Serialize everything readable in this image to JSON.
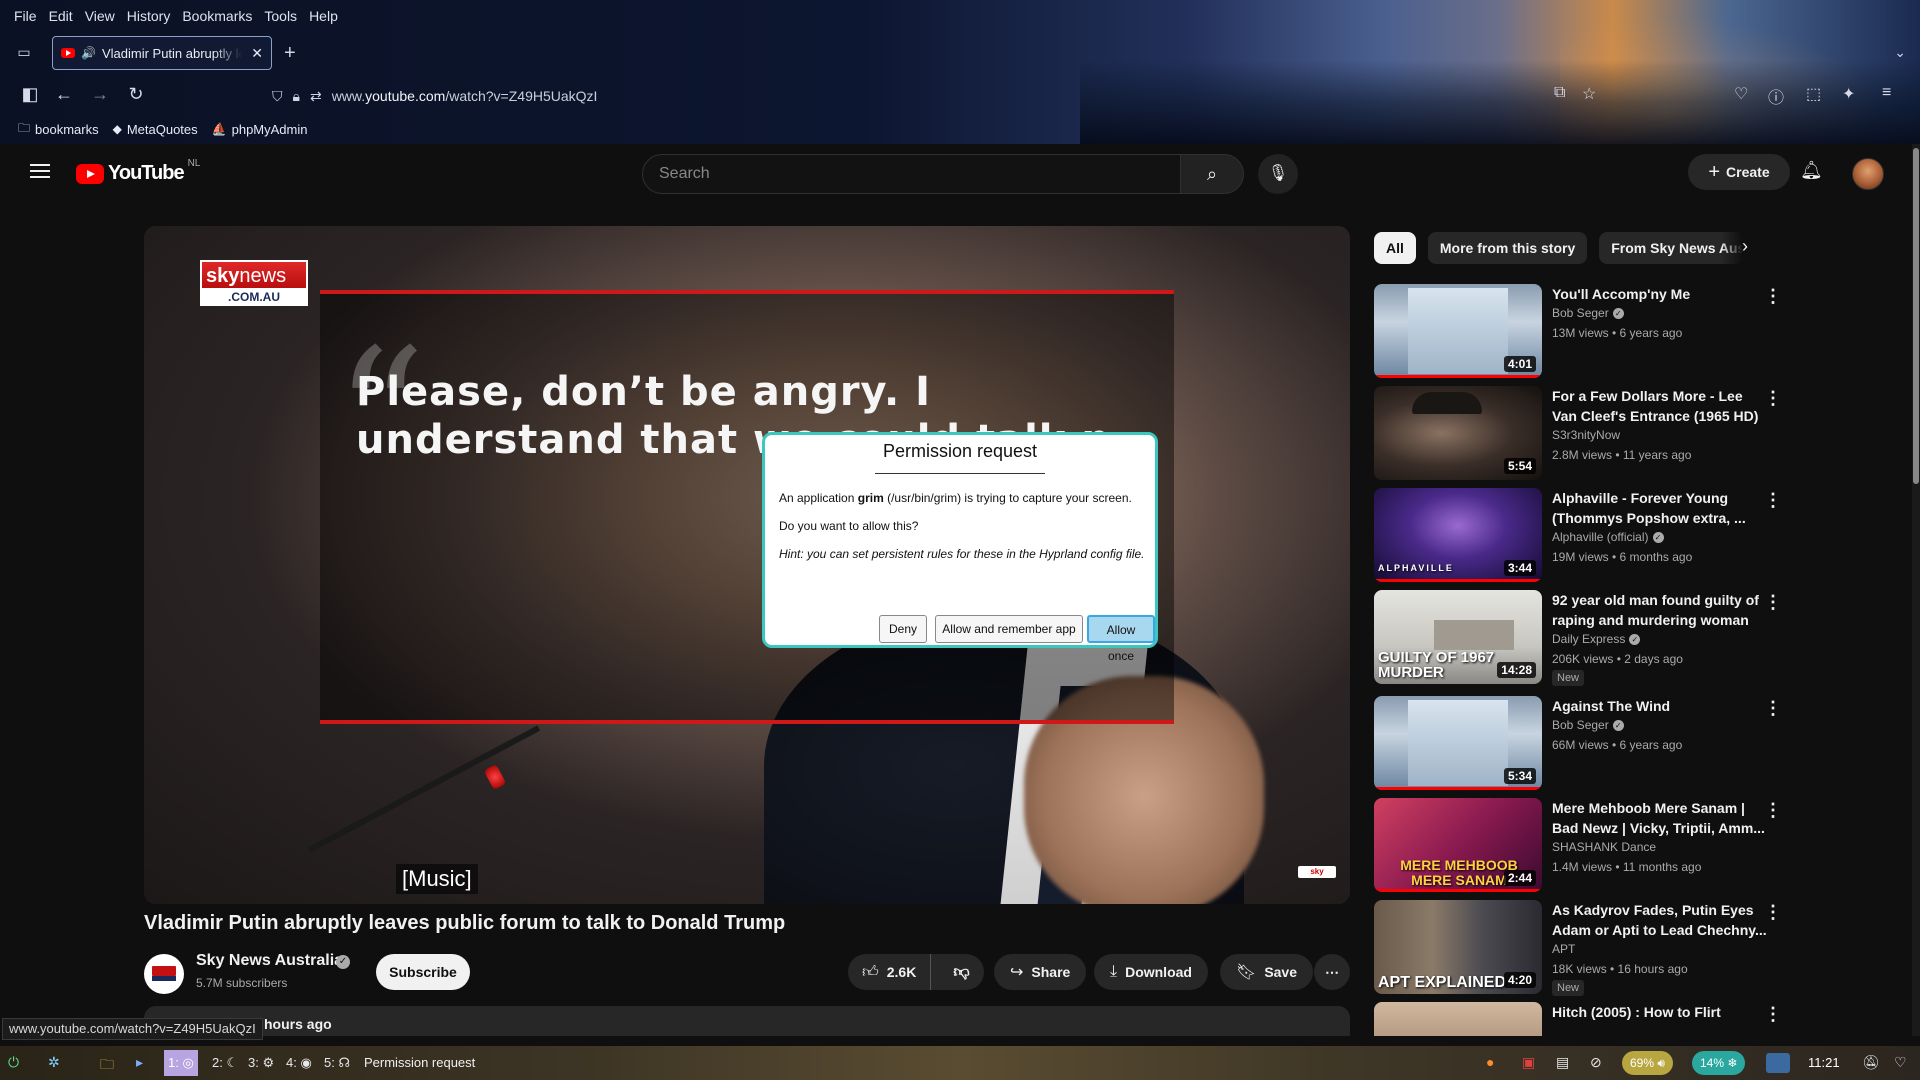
{
  "browser": {
    "menu": [
      "File",
      "Edit",
      "View",
      "History",
      "Bookmarks",
      "Tools",
      "Help"
    ],
    "tab_title": "Vladimir Putin abruptly leaves public forum to talk to Donald Trump",
    "url_prefix": "www.",
    "url_domain": "youtube.com",
    "url_path": "/watch?v=Z49H5UakQzI",
    "bookmarks": [
      "bookmarks",
      "MetaQuotes",
      "phpMyAdmin"
    ],
    "status_url": "www.youtube.com/watch?v=Z49H5UakQzI"
  },
  "youtube": {
    "logo_text": "YouTube",
    "region": "NL",
    "search_placeholder": "Search",
    "create_label": "Create"
  },
  "video": {
    "overlay_logo_top": "sky",
    "overlay_logo_top2": "news",
    "overlay_logo_bottom": ".COM.AU",
    "quote_text": "Please, don’t be angry. I understand that we could talk n",
    "caption": "[Music]",
    "title": "Vladimir Putin abruptly leaves public forum to talk to Donald Trump",
    "channel": "Sky News Australia",
    "subscribers": "5.7M subscribers",
    "subscribe_label": "Subscribe",
    "likes": "2.6K",
    "share_label": "Share",
    "download_label": "Download",
    "save_label": "Save",
    "desc_snippet": "hours ago"
  },
  "chips": [
    "All",
    "More from this story",
    "From Sky News Australia"
  ],
  "recommendations": [
    {
      "title": "You'll Accomp'ny Me",
      "channel": "Bob Seger",
      "verified": true,
      "meta": "13M views • 6 years ago",
      "duration": "4:01",
      "is_new": false,
      "progress": 1.0
    },
    {
      "title": "For a Few Dollars More - Lee Van Cleef's Entrance (1965 HD)",
      "channel": "S3r3nityNow",
      "verified": false,
      "meta": "2.8M views • 11 years ago",
      "duration": "5:54",
      "is_new": false,
      "progress": 0
    },
    {
      "title": "Alphaville - Forever Young (Thommys Popshow extra, ...",
      "channel": "Alphaville (official)",
      "verified": true,
      "meta": "19M views • 6 months ago",
      "duration": "3:44",
      "is_new": false,
      "progress": 1.0,
      "overlay": "ALPHAVILLE"
    },
    {
      "title": "92 year old man found guilty of raping and murdering woman i...",
      "channel": "Daily Express",
      "verified": true,
      "meta": "206K views • 2 days ago",
      "duration": "14:28",
      "is_new": true,
      "progress": 0,
      "overlay": "GUILTY OF 1967 MURDER"
    },
    {
      "title": "Against The Wind",
      "channel": "Bob Seger",
      "verified": true,
      "meta": "66M views • 6 years ago",
      "duration": "5:34",
      "is_new": false,
      "progress": 1.0
    },
    {
      "title": "Mere Mehboob Mere Sanam | Bad Newz | Vicky, Triptii, Amm...",
      "channel": "SHASHANK Dance",
      "verified": false,
      "meta": "1.4M views • 11 months ago",
      "duration": "2:44",
      "is_new": false,
      "progress": 1.0,
      "overlay": "MERE MEHBOOB MERE SANAM"
    },
    {
      "title": "As Kadyrov Fades, Putin Eyes Adam or Apti to Lead Chechny...",
      "channel": "APT",
      "verified": false,
      "meta": "18K views • 16 hours ago",
      "duration": "4:20",
      "is_new": true,
      "progress": 0,
      "overlay": "APT EXPLAINED"
    },
    {
      "title": "Hitch (2005) : How to Flirt",
      "channel": "",
      "verified": false,
      "meta": "",
      "duration": "",
      "is_new": false,
      "progress": 0
    }
  ],
  "new_label": "New",
  "dialog": {
    "title": "Permission request",
    "line1_pre": "An application ",
    "line1_app": "grim",
    "line1_post": " (/usr/bin/grim) is trying to capture your screen.",
    "line2": "Do you want to allow this?",
    "hint": "Hint: you can set persistent rules for these in the Hyprland config file.",
    "deny": "Deny",
    "allow_remember": "Allow and remember app",
    "allow_once": "Allow once"
  },
  "taskbar": {
    "workspaces": [
      "1:",
      "2:",
      "3:",
      "4:",
      "5:"
    ],
    "window_label": "Permission request",
    "battery": "69%",
    "cpu": "14%",
    "clock": "11:21"
  },
  "colors": {
    "accent_red": "#ff0000",
    "dialog_border": "#3cc6c0",
    "primary_button": "#a8d8f0"
  }
}
